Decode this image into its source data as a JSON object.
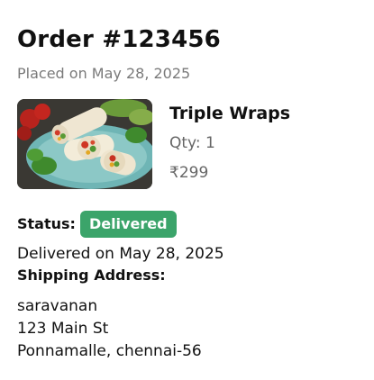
{
  "order": {
    "title": "Order #123456",
    "placed_on": "Placed on May 28, 2025"
  },
  "item": {
    "image_alt": "Triple Wraps photo",
    "name": "Triple Wraps",
    "qty_prefix": "Qty: ",
    "qty": "1",
    "price": "₹299"
  },
  "status": {
    "label": "Status:",
    "badge": "Delivered",
    "badge_color": "#3ba46a",
    "delivered_on": "Delivered on May 28, 2025"
  },
  "shipping": {
    "heading": "Shipping Address:",
    "lines": [
      "saravanan",
      "123 Main St",
      "Ponnamalle, chennai-56"
    ]
  }
}
